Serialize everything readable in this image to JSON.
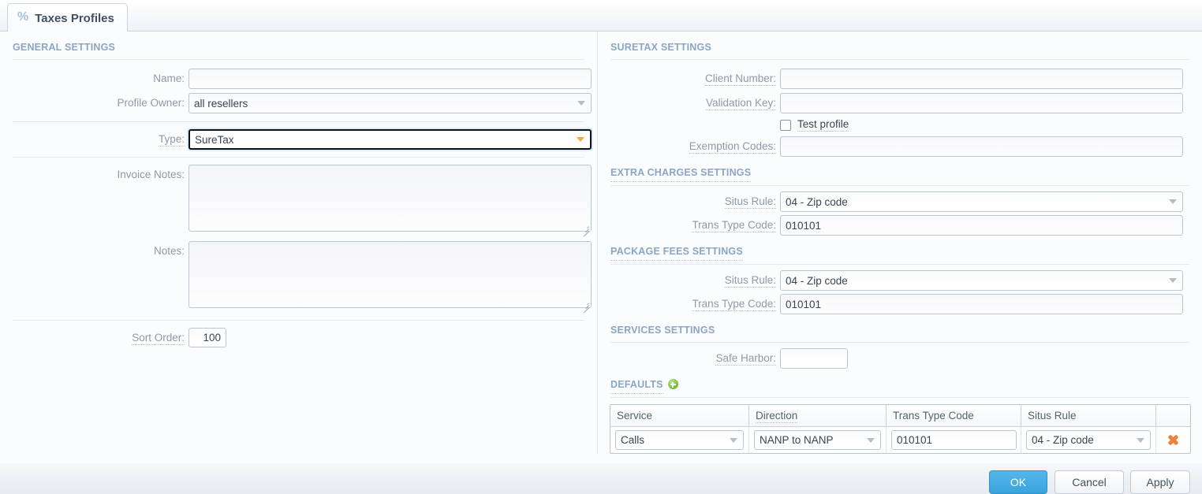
{
  "tab": {
    "label": "Taxes Profiles",
    "icon": "percent-icon"
  },
  "sections": {
    "general": "GENERAL SETTINGS",
    "suretax": "SURETAX SETTINGS",
    "extra_charges": "EXTRA CHARGES SETTINGS",
    "package_fees": "PACKAGE FEES SETTINGS",
    "services": "SERVICES SETTINGS",
    "defaults": "DEFAULTS"
  },
  "general": {
    "name_label": "Name:",
    "name_value": "",
    "profile_owner_label": "Profile Owner:",
    "profile_owner_value": "all resellers",
    "type_label": "Type:",
    "type_value": "SureTax",
    "invoice_notes_label": "Invoice Notes:",
    "invoice_notes_value": "",
    "notes_label": "Notes:",
    "notes_value": "",
    "sort_order_label": "Sort Order:",
    "sort_order_value": "100"
  },
  "suretax": {
    "client_number_label": "Client Number:",
    "client_number_value": "",
    "validation_key_label": "Validation Key:",
    "validation_key_value": "",
    "test_profile_label": "Test profile",
    "test_profile_checked": false,
    "exemption_codes_label": "Exemption Codes:",
    "exemption_codes_value": ""
  },
  "extra_charges": {
    "situs_rule_label": "Situs Rule:",
    "situs_rule_value": "04 - Zip code",
    "trans_type_code_label": "Trans Type Code:",
    "trans_type_code_value": "010101"
  },
  "package_fees": {
    "situs_rule_label": "Situs Rule:",
    "situs_rule_value": "04 - Zip code",
    "trans_type_code_label": "Trans Type Code:",
    "trans_type_code_value": "010101"
  },
  "services": {
    "safe_harbor_label": "Safe Harbor:",
    "safe_harbor_value": ""
  },
  "defaults_table": {
    "headers": [
      "Service",
      "Direction",
      "Trans Type Code",
      "Situs Rule"
    ],
    "rows": [
      {
        "service": "Calls",
        "direction": "NANP to NANP",
        "trans_type_code": "010101",
        "situs_rule": "04 - Zip code"
      }
    ]
  },
  "footer": {
    "ok": "OK",
    "cancel": "Cancel",
    "apply": "Apply"
  },
  "colors": {
    "section_header": "#8ba6c4",
    "label": "#8e9aa6",
    "primary_button": "#3aa4df",
    "add_icon": "#7cc043",
    "delete_icon": "#e8833a",
    "focus_caret": "#f0ad26"
  }
}
